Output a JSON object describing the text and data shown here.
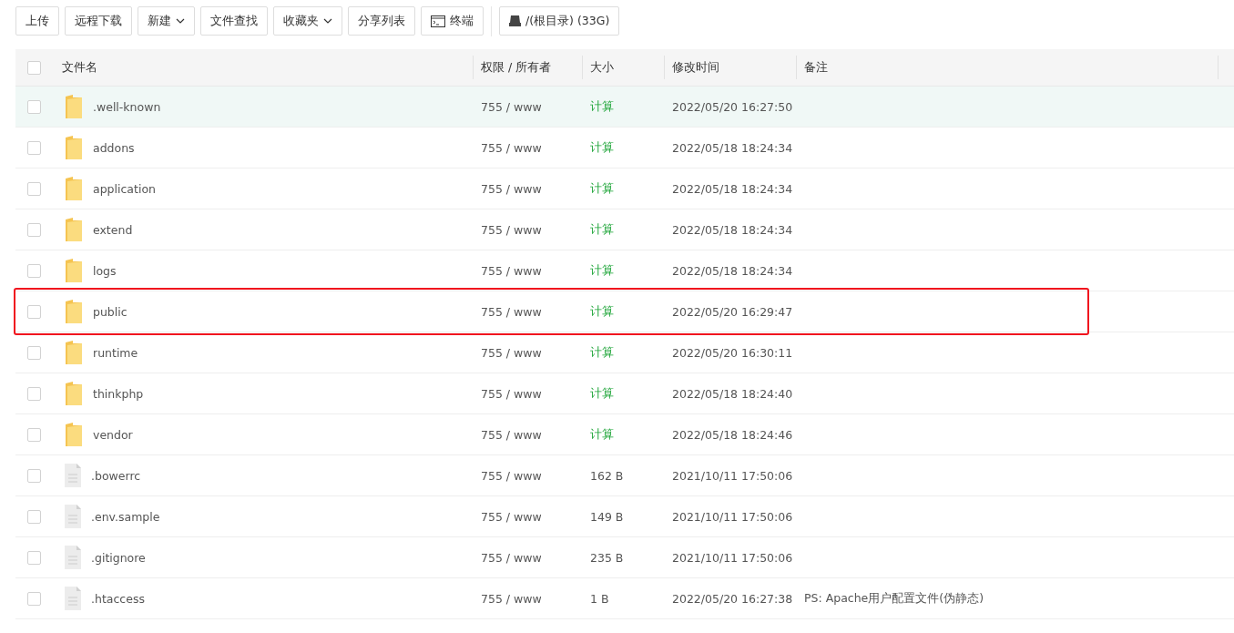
{
  "toolbar": [
    {
      "label": "上传",
      "kind": "plain"
    },
    {
      "label": "远程下载",
      "kind": "plain"
    },
    {
      "label": "新建",
      "kind": "dropdown"
    },
    {
      "label": "文件查找",
      "kind": "plain"
    },
    {
      "label": "收藏夹",
      "kind": "dropdown"
    },
    {
      "label": "分享列表",
      "kind": "plain"
    },
    {
      "label": "终端",
      "kind": "terminal"
    },
    {
      "label": "/(根目录) (33G)",
      "kind": "disk"
    }
  ],
  "table": {
    "select_all": {
      "checked": false
    },
    "columns": [
      "文件名",
      "权限 / 所有者",
      "大小",
      "修改时间",
      "备注"
    ],
    "rows": [
      {
        "kind": "folder",
        "name": ".well-known",
        "perms": "755 / www",
        "size": "计算",
        "size_link": true,
        "modified": "2022/05/20 16:27:50",
        "hovered": true,
        "annotated": false,
        "checked": false
      },
      {
        "kind": "folder",
        "name": "addons",
        "perms": "755 / www",
        "size": "计算",
        "size_link": true,
        "modified": "2022/05/18 18:24:34",
        "hovered": false,
        "annotated": false,
        "checked": false
      },
      {
        "kind": "folder",
        "name": "application",
        "perms": "755 / www",
        "size": "计算",
        "size_link": true,
        "modified": "2022/05/18 18:24:34",
        "hovered": false,
        "annotated": false,
        "checked": false
      },
      {
        "kind": "folder",
        "name": "extend",
        "perms": "755 / www",
        "size": "计算",
        "size_link": true,
        "modified": "2022/05/18 18:24:34",
        "hovered": false,
        "annotated": false,
        "checked": false
      },
      {
        "kind": "folder",
        "name": "logs",
        "perms": "755 / www",
        "size": "计算",
        "size_link": true,
        "modified": "2022/05/18 18:24:34",
        "hovered": false,
        "annotated": false,
        "checked": false
      },
      {
        "kind": "folder",
        "name": "public",
        "perms": "755 / www",
        "size": "计算",
        "size_link": true,
        "modified": "2022/05/20 16:29:47",
        "hovered": false,
        "annotated": true,
        "checked": false
      },
      {
        "kind": "folder",
        "name": "runtime",
        "perms": "755 / www",
        "size": "计算",
        "size_link": true,
        "modified": "2022/05/20 16:30:11",
        "hovered": false,
        "annotated": false,
        "checked": false
      },
      {
        "kind": "folder",
        "name": "thinkphp",
        "perms": "755 / www",
        "size": "计算",
        "size_link": true,
        "modified": "2022/05/18 18:24:40",
        "hovered": false,
        "annotated": false,
        "checked": false
      },
      {
        "kind": "folder",
        "name": "vendor",
        "perms": "755 / www",
        "size": "计算",
        "size_link": true,
        "modified": "2022/05/18 18:24:46",
        "hovered": false,
        "annotated": false,
        "checked": false
      },
      {
        "kind": "file",
        "name": ".bowerrc",
        "perms": "755 / www",
        "size": "162 B",
        "size_link": false,
        "modified": "2021/10/11 17:50:06",
        "hovered": false,
        "annotated": false,
        "checked": false
      },
      {
        "kind": "file",
        "name": ".env.sample",
        "perms": "755 / www",
        "size": "149 B",
        "size_link": false,
        "modified": "2021/10/11 17:50:06",
        "hovered": false,
        "annotated": false,
        "checked": false
      },
      {
        "kind": "file",
        "name": ".gitignore",
        "perms": "755 / www",
        "size": "235 B",
        "size_link": false,
        "modified": "2021/10/11 17:50:06",
        "hovered": false,
        "annotated": false,
        "checked": false
      },
      {
        "kind": "file",
        "name": ".htaccess",
        "perms": "755 / www",
        "size": "1 B",
        "size_link": false,
        "modified": "2022/05/20 16:27:38",
        "note": "PS: Apache用户配置文件(伪静态)",
        "hovered": false,
        "annotated": false,
        "checked": false
      }
    ]
  }
}
